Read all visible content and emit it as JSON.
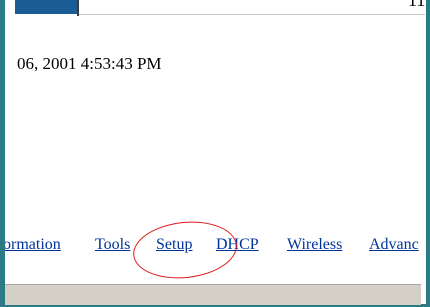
{
  "header": {
    "corner_text": "11"
  },
  "content": {
    "datetime": "06, 2001 4:53:43 PM"
  },
  "nav": {
    "items": [
      {
        "label": "ormation"
      },
      {
        "label": "Tools"
      },
      {
        "label": "Setup"
      },
      {
        "label": "DHCP"
      },
      {
        "label": "Wireless"
      },
      {
        "label": "Advanc"
      }
    ]
  },
  "colors": {
    "frame": "#2d7a87",
    "header_block": "#1b5c95",
    "link": "#003399",
    "highlight": "#e01818",
    "status_bar": "#d4d0c8"
  }
}
